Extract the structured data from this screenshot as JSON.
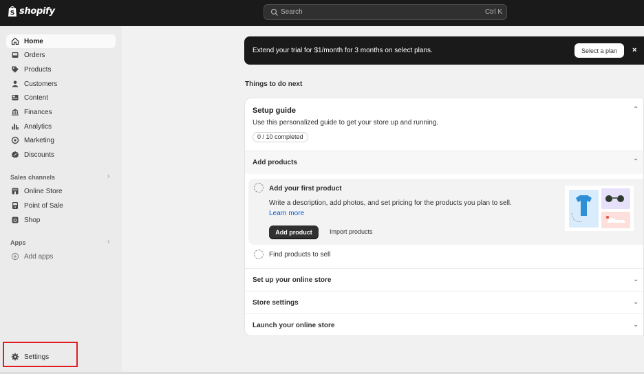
{
  "topbar": {
    "logo_text": "shopify",
    "search_placeholder": "Search",
    "search_shortcut": "Ctrl K"
  },
  "sidebar": {
    "main_items": [
      {
        "label": "Home",
        "icon": "home-icon",
        "active": true
      },
      {
        "label": "Orders",
        "icon": "inbox-icon"
      },
      {
        "label": "Products",
        "icon": "tag-icon"
      },
      {
        "label": "Customers",
        "icon": "person-icon"
      },
      {
        "label": "Content",
        "icon": "image-icon"
      },
      {
        "label": "Finances",
        "icon": "bank-icon"
      },
      {
        "label": "Analytics",
        "icon": "bar-chart-icon"
      },
      {
        "label": "Marketing",
        "icon": "target-icon"
      },
      {
        "label": "Discounts",
        "icon": "discount-icon"
      }
    ],
    "sales_channels_title": "Sales channels",
    "sales_channels": [
      {
        "label": "Online Store",
        "icon": "storefront-icon"
      },
      {
        "label": "Point of Sale",
        "icon": "pos-icon"
      },
      {
        "label": "Shop",
        "icon": "shop-icon"
      }
    ],
    "apps_title": "Apps",
    "add_apps_label": "Add apps",
    "settings_label": "Settings"
  },
  "banner": {
    "text": "Extend your trial for $1/month for 3 months on select plans.",
    "button_label": "Select a plan",
    "close_glyph": "×"
  },
  "main": {
    "things_title": "Things to do next",
    "guide": {
      "title": "Setup guide",
      "description": "Use this personalized guide to get your store up and running.",
      "progress": "0 / 10 completed"
    },
    "add_products": {
      "title": "Add products",
      "task": {
        "title": "Add your first product",
        "description": "Write a description, add photos, and set pricing for the products you plan to sell.",
        "learn_more": "Learn more",
        "primary_button": "Add product",
        "secondary_button": "Import products"
      },
      "second_task": "Find products to sell"
    },
    "sections": [
      {
        "label": "Set up your online store"
      },
      {
        "label": "Store settings"
      },
      {
        "label": "Launch your online store"
      }
    ]
  },
  "colors": {
    "topbar_bg": "#1a1a1a",
    "sidebar_bg": "#ebebeb",
    "link": "#005bd3",
    "highlight_box": "#e31b23"
  }
}
